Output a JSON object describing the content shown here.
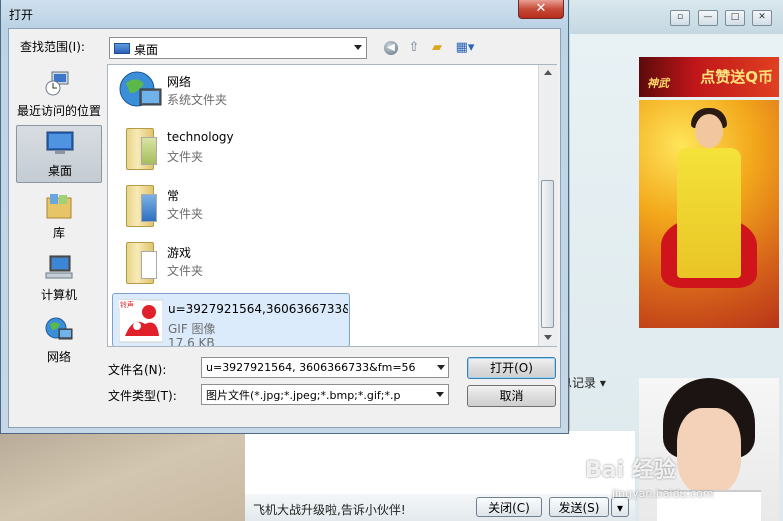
{
  "dialog": {
    "title": "打开",
    "close_glyph": "✕",
    "look_in_label": "查找范围(I):",
    "look_in_value": "桌面"
  },
  "places": [
    {
      "label": "最近访问的位置",
      "icon": "recent-places-icon"
    },
    {
      "label": "桌面",
      "icon": "desktop-icon",
      "selected": true
    },
    {
      "label": "库",
      "icon": "libraries-icon"
    },
    {
      "label": "计算机",
      "icon": "computer-icon"
    },
    {
      "label": "网络",
      "icon": "network-icon"
    }
  ],
  "files": [
    {
      "name": "网络",
      "type": "系统文件夹",
      "icon": "network-icon"
    },
    {
      "name": "technology",
      "type": "文件夹",
      "icon": "folder-icon"
    },
    {
      "name": "常",
      "type": "文件夹",
      "icon": "folder-icon"
    },
    {
      "name": "游戏",
      "type": "文件夹",
      "icon": "folder-icon"
    },
    {
      "name": "u=3927921564,3606366733&...",
      "type": "GIF 图像",
      "size": "17.6 KB",
      "icon": "gif-thumbnail",
      "selected": true
    }
  ],
  "file_name_label": "文件名(N):",
  "file_name_value": "u=3927921564, 3606366733&fm=56",
  "file_type_label": "文件类型(T):",
  "file_type_value": "图片文件(*.jpg;*.jpeg;*.bmp;*.gif;*.p",
  "open_button": "打开(O)",
  "cancel_button": "取消",
  "chat": {
    "ad_banner": "点赞送Q币",
    "ad_logo": "神武",
    "history_label": "息记录 ▾",
    "status": "飞机大战升级啦,告诉小伙伴!",
    "close_button": "关闭(C)",
    "send_button": "发送(S)",
    "window_controls": [
      "▫",
      "—",
      "□",
      "✕"
    ]
  },
  "watermark": {
    "text": "Bai 经验",
    "url": "jingyan.baidu.com"
  },
  "colors": {
    "accent": "#3c7fb1",
    "selection": "#dcebfc",
    "close_red": "#c74a38"
  }
}
